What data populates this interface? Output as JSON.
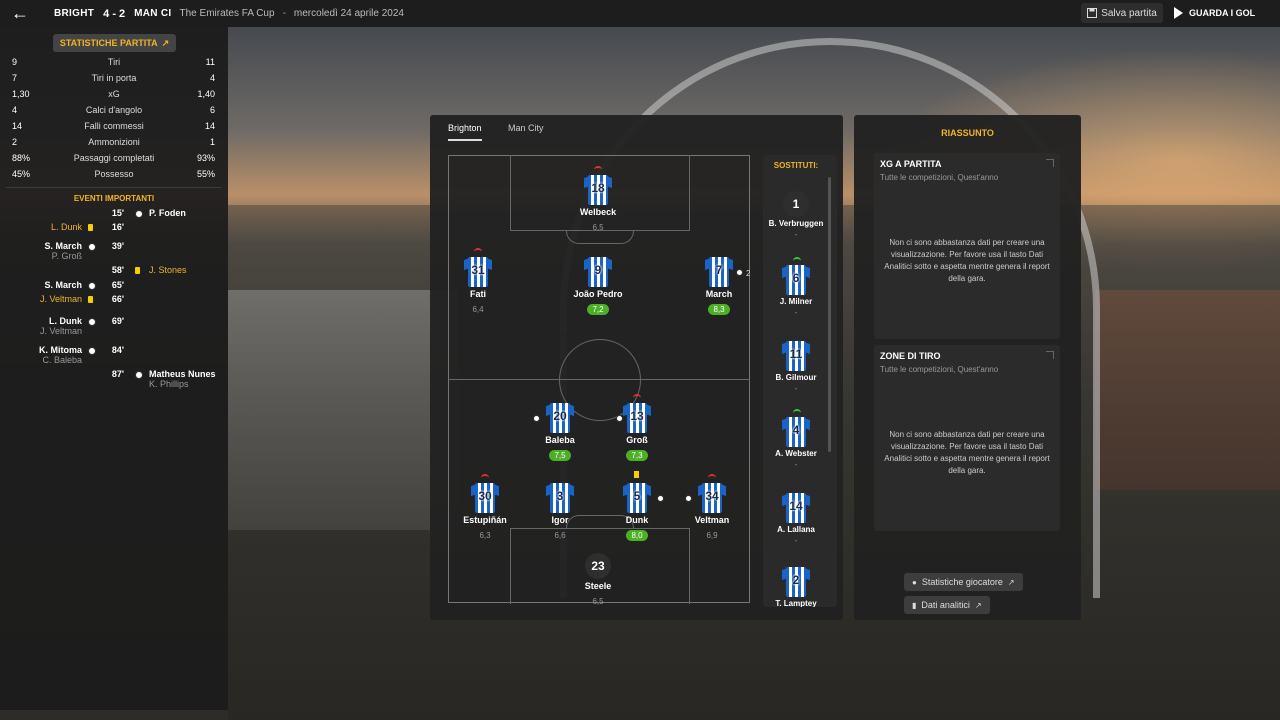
{
  "topbar": {
    "back_icon": "arrow-left-icon",
    "home_team": "BRIGHT",
    "score": "4 - 2",
    "away_team": "MAN CI",
    "competition": "The Emirates FA Cup",
    "separator": "-",
    "date": "mercoledì 24 aprile 2024",
    "save_label": "Salva partita",
    "watch_label": "GUARDA I GOL"
  },
  "stats": {
    "title": "STATISTICHE PARTITA",
    "rows": [
      {
        "home": "9",
        "label": "Tiri",
        "away": "11"
      },
      {
        "home": "7",
        "label": "Tiri in porta",
        "away": "4"
      },
      {
        "home": "1,30",
        "label": "xG",
        "away": "1,40"
      },
      {
        "home": "4",
        "label": "Calci d'angolo",
        "away": "6"
      },
      {
        "home": "14",
        "label": "Falli commessi",
        "away": "14"
      },
      {
        "home": "2",
        "label": "Ammonizioni",
        "away": "1"
      },
      {
        "home": "88%",
        "label": "Passaggi completati",
        "away": "93%"
      },
      {
        "home": "45%",
        "label": "Possesso",
        "away": "55%"
      }
    ]
  },
  "events": {
    "title": "EVENTI IMPORTANTI",
    "items": [
      {
        "minute": "15'",
        "side": "away",
        "type": "goal",
        "name": "P. Foden",
        "sub": ""
      },
      {
        "minute": "16'",
        "side": "home",
        "type": "card",
        "name": "L. Dunk",
        "sub": ""
      },
      {
        "minute": "39'",
        "side": "home",
        "type": "goal",
        "name": "S. March",
        "sub": "P. Groß"
      },
      {
        "minute": "58'",
        "side": "away",
        "type": "card",
        "name": "J. Stones",
        "sub": ""
      },
      {
        "minute": "65'",
        "side": "home",
        "type": "goal",
        "name": "S. March",
        "sub": ""
      },
      {
        "minute": "66'",
        "side": "home",
        "type": "card",
        "name": "J. Veltman",
        "sub": ""
      },
      {
        "minute": "69'",
        "side": "home",
        "type": "goal",
        "name": "L. Dunk",
        "sub": "J. Veltman"
      },
      {
        "minute": "84'",
        "side": "home",
        "type": "goal",
        "name": "K. Mitoma",
        "sub": "C. Baleba"
      },
      {
        "minute": "87'",
        "side": "away",
        "type": "goal",
        "name": "Matheus Nunes",
        "sub": "K. Phillips"
      }
    ]
  },
  "lineup": {
    "tabs": [
      "Brighton",
      "Man City"
    ],
    "active_tab": "Brighton",
    "players": [
      {
        "number": "18",
        "name": "Welbeck",
        "rating": "6,5",
        "good": false
      },
      {
        "number": "31",
        "name": "Fati",
        "rating": "6,4",
        "good": false
      },
      {
        "number": "9",
        "name": "João Pedro",
        "rating": "7,2",
        "good": true
      },
      {
        "number": "7",
        "name": "March",
        "rating": "8,3",
        "good": true,
        "goals": "2"
      },
      {
        "number": "20",
        "name": "Baleba",
        "rating": "7,5",
        "good": true
      },
      {
        "number": "13",
        "name": "Groß",
        "rating": "7,3",
        "good": true
      },
      {
        "number": "30",
        "name": "Estupiñán",
        "rating": "6,3",
        "good": false
      },
      {
        "number": "3",
        "name": "Igor",
        "rating": "6,6",
        "good": false
      },
      {
        "number": "5",
        "name": "Dunk",
        "rating": "8,0",
        "good": true
      },
      {
        "number": "34",
        "name": "Veltman",
        "rating": "6,9",
        "good": false
      },
      {
        "number": "23",
        "name": "Steele",
        "rating": "6,5",
        "good": false
      }
    ]
  },
  "subs": {
    "title": "SOSTITUTI:",
    "players": [
      {
        "number": "1",
        "name": "B. Verbruggen",
        "rating": "-"
      },
      {
        "number": "6",
        "name": "J. Milner",
        "rating": "-"
      },
      {
        "number": "11",
        "name": "B. Gilmour",
        "rating": "-"
      },
      {
        "number": "4",
        "name": "A. Webster",
        "rating": "-"
      },
      {
        "number": "14",
        "name": "A. Lallana",
        "rating": "-"
      },
      {
        "number": "2",
        "name": "T. Lamptey",
        "rating": ""
      }
    ]
  },
  "summary": {
    "title": "RIASSUNTO",
    "cards": [
      {
        "title": "XG A PARTITA",
        "subtitle": "Tutte le competizioni, Quest'anno",
        "message": "Non ci sono abbastanza dati per creare una visualizzazione. Per favore usa il tasto Dati Analitici sotto e aspetta mentre genera il report della gara."
      },
      {
        "title": "ZONE DI TIRO",
        "subtitle": "Tutte le competizioni, Quest'anno",
        "message": "Non ci sono abbastanza dati per creare una visualizzazione. Per favore usa il tasto Dati Analitici sotto e aspetta mentre genera il report della gara."
      }
    ],
    "player_stats_label": "Statistiche giocatore",
    "analytics_label": "Dati analitici"
  },
  "colors": {
    "accent": "#f0b429",
    "good_rating": "#4caf26",
    "panel": "#212121",
    "shirt_blue": "#1a64c8"
  }
}
